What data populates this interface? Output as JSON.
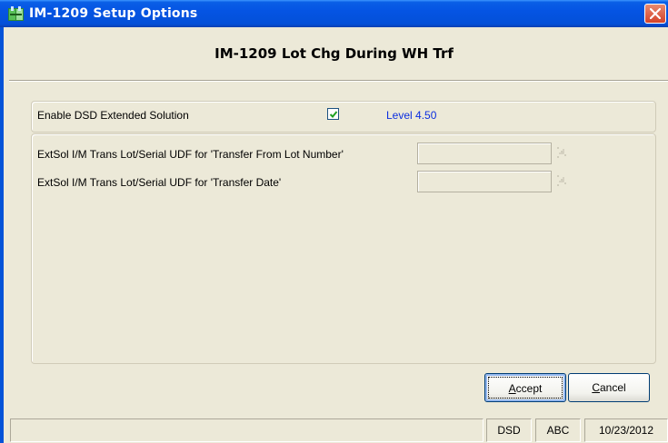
{
  "window": {
    "title": "IM-1209 Setup Options",
    "icon": "sage-mas-app-icon",
    "close_icon": "close-icon"
  },
  "header": {
    "title": "IM-1209 Lot Chg During WH Trf"
  },
  "settings": {
    "enable_label": "Enable DSD Extended Solution",
    "enable_checked": true,
    "level_text": "Level  4.50",
    "fields": [
      {
        "label": "ExtSol I/M Trans Lot/Serial UDF for 'Transfer From Lot Number'",
        "value": ""
      },
      {
        "label": "ExtSol I/M Trans Lot/Serial UDF for 'Transfer Date'",
        "value": ""
      }
    ]
  },
  "buttons": {
    "accept_prefix": "A",
    "accept_rest": "ccept",
    "cancel_prefix": "C",
    "cancel_rest": "ancel"
  },
  "statusbar": {
    "main": "",
    "company_code": "DSD",
    "company_abbrev": "ABC",
    "date": "10/23/2012"
  },
  "colors": {
    "titlebar": "#0554e3",
    "level_text": "#0b2ee0",
    "dialog_bg": "#ece9d8"
  }
}
